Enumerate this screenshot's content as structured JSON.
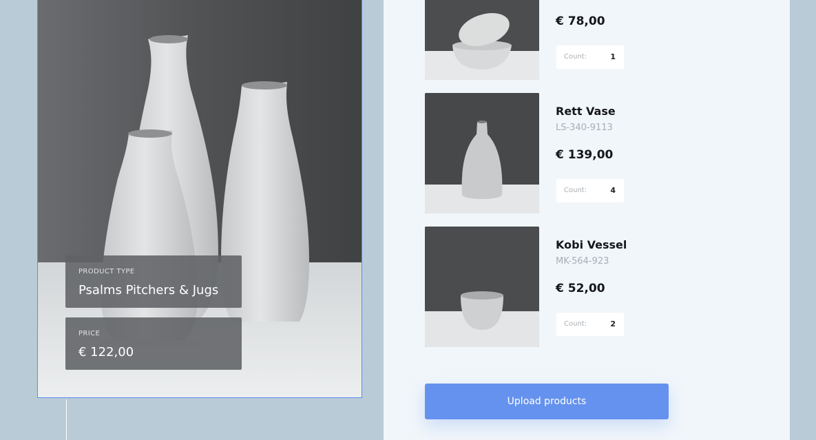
{
  "hero": {
    "product_type_caption": "PRODUCT TYPE",
    "product_type": "Psalms Pitchers & Jugs",
    "price_caption": "PRICE",
    "price": "€ 122,00"
  },
  "cart": {
    "items": [
      {
        "name": "",
        "sku": "",
        "price": "€ 78,00",
        "count_label": "Count:",
        "count": "1"
      },
      {
        "name": "Rett Vase",
        "sku": "LS-340-9113",
        "price": "€ 139,00",
        "count_label": "Count:",
        "count": "4"
      },
      {
        "name": "Kobi Vessel",
        "sku": "MK-564-923",
        "price": "€ 52,00",
        "count_label": "Count:",
        "count": "2"
      }
    ],
    "upload_label": "Upload products"
  },
  "colors": {
    "background": "#b8cbd6",
    "panel": "#f1f6fa",
    "accent": "#6592ee",
    "selection": "#5b8cf0"
  }
}
